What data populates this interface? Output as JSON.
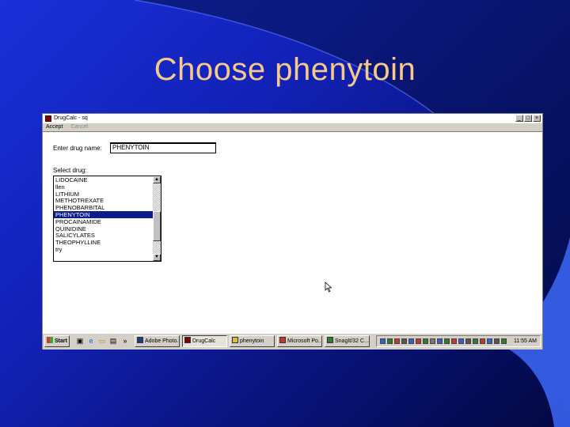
{
  "slide": {
    "title": "Choose phenytoin"
  },
  "window": {
    "title": "DrugCalc - sq",
    "menu": [
      {
        "label": "Accept",
        "enabled": true
      },
      {
        "label": "Cancel",
        "enabled": false
      }
    ],
    "buttons": {
      "minimize": "_",
      "maximize": "□",
      "close": "×"
    }
  },
  "form": {
    "drug_name_label": "Enter drug name:",
    "drug_name_value": "PHENYTOIN",
    "select_label": "Select drug:",
    "drugs": [
      "LIDOCAINE",
      "llen",
      "LITHIUM",
      "METHOTREXATE",
      "PHENOBARBITAL",
      "PHENYTOIN",
      "PROCAINAMIDE",
      "QUINIDINE",
      "SALICYLATES",
      "THEOPHYLLINE",
      "try"
    ],
    "selected_drug": "PHENYTOIN"
  },
  "taskbar": {
    "start_label": "Start",
    "quick_launch": [
      "desktop-icon",
      "internet-explorer-icon",
      "folder-icon",
      "more-icon"
    ],
    "overflow": "»",
    "tasks": [
      {
        "label": "Adobe Photo...",
        "active": false,
        "icon_color": "#1d3a8a"
      },
      {
        "label": "DrugCalc",
        "active": true,
        "icon_color": "#800000"
      },
      {
        "label": "phenytoin",
        "active": false,
        "icon_color": "#e0b84a"
      },
      {
        "label": "Microsoft Po...",
        "active": false,
        "icon_color": "#c0392b"
      },
      {
        "label": "SnagIt/32 C...",
        "active": false,
        "icon_color": "#2e7d32"
      }
    ],
    "tray_icon_colors": [
      "#3a5fcd",
      "#2e7d32",
      "#c0392b",
      "#555555",
      "#3a5fcd",
      "#c0392b",
      "#2e7d32",
      "#777777",
      "#3a5fcd",
      "#2e7d32",
      "#c0392b",
      "#3a5fcd",
      "#555555",
      "#2e7d32",
      "#c0392b",
      "#3a5fcd",
      "#555555",
      "#2e7d32"
    ],
    "clock": "11:55 AM"
  },
  "colors": {
    "title_text": "#f6c98a",
    "selection": "#0a1d8a"
  }
}
